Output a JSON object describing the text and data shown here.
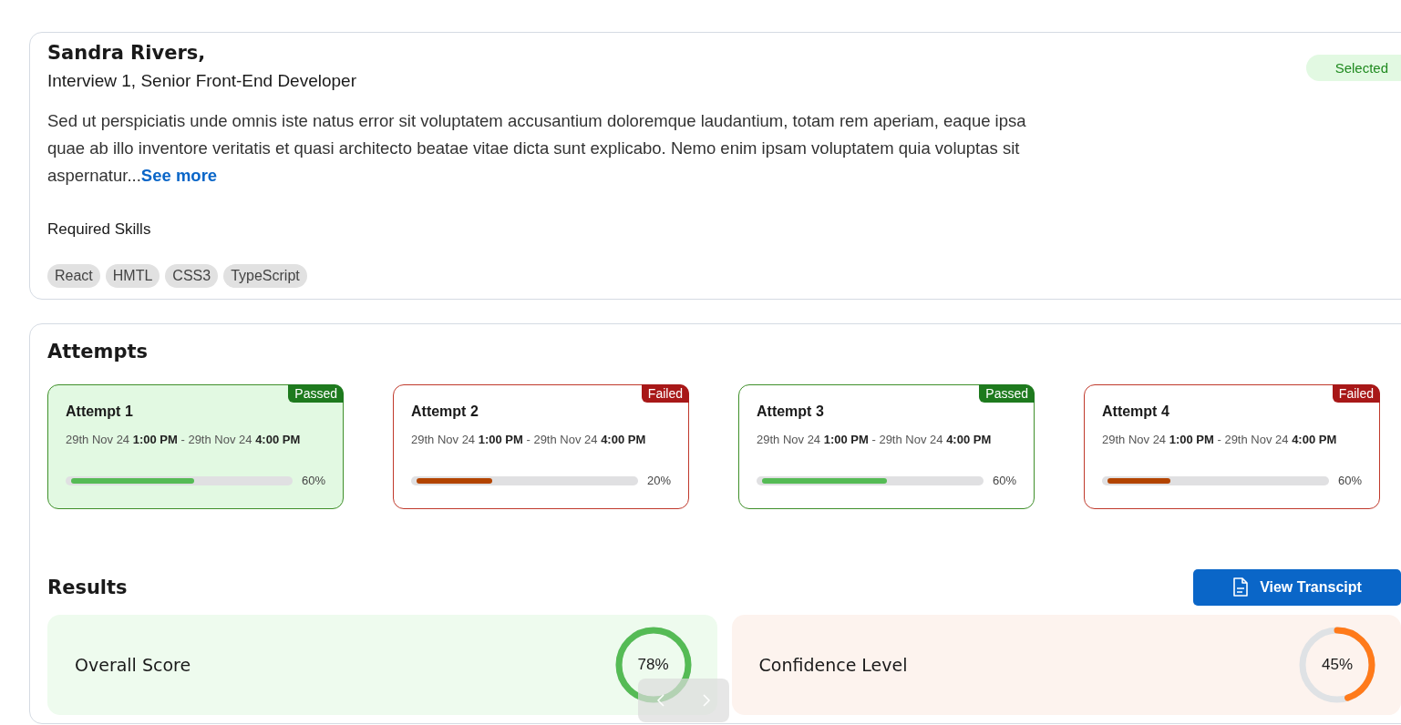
{
  "candidate": {
    "name": "Sandra Rivers,",
    "subtitle": "Interview 1, Senior Front-End Developer",
    "status": "Selected",
    "description": "Sed ut perspiciatis unde omnis iste natus error sit voluptatem accusantium doloremque laudantium, totam rem aperiam, eaque ipsa quae ab illo inventore veritatis et quasi architecto beatae vitae dicta sunt explicabo. Nemo enim ipsam voluptatem quia voluptas sit aspernatur...",
    "see_more": "See more",
    "skills_title": "Required Skills",
    "skills": [
      "React",
      "HMTL",
      "CSS3",
      "TypeScript"
    ]
  },
  "attempts": {
    "title": "Attempts",
    "items": [
      {
        "title": "Attempt 1",
        "result": "Passed",
        "kind": "passed",
        "selected": true,
        "time": "29th Nov 24 **1:00 PM** - 29th Nov 24 **4:00 PM**",
        "level": 0.57,
        "reading": "60%"
      },
      {
        "title": "Attempt 2",
        "result": "Failed",
        "kind": "failed",
        "selected": false,
        "time": "29th Nov 24 **1:00 PM** - 29th Nov 24 **4:00 PM**",
        "level": 0.35,
        "reading": "20%"
      },
      {
        "title": "Attempt 3",
        "result": "Passed",
        "kind": "passed",
        "selected": false,
        "time": "29th Nov 24 **1:00 PM** - 29th Nov 24 **4:00 PM**",
        "level": 0.58,
        "reading": "60%"
      },
      {
        "title": "Attempt 4",
        "result": "Failed",
        "kind": "failed",
        "selected": false,
        "time": "29th Nov 24 **1:00 PM** - 29th Nov 24 **4:00 PM**",
        "level": 0.29,
        "reading": "60%"
      }
    ]
  },
  "results": {
    "title": "Results",
    "button": "View Transcipt",
    "scores": [
      {
        "label": "Overall Score",
        "kind": "good",
        "level": 1,
        "reading": "78%"
      },
      {
        "label": "Confidence Level",
        "kind": "warn",
        "level": 0.45,
        "reading": "45%"
      }
    ]
  }
}
